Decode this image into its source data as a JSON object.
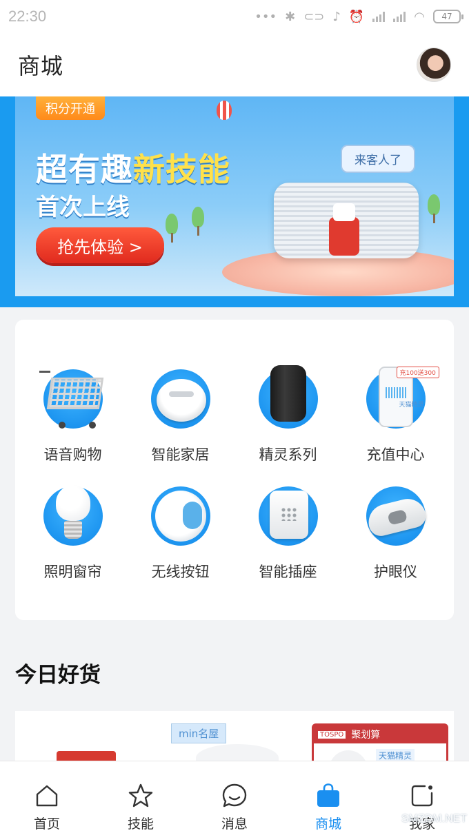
{
  "status_bar": {
    "time": "22:30",
    "battery": "47"
  },
  "header": {
    "title": "商城"
  },
  "banner": {
    "badge": "积分开通",
    "headline_a": "超有趣",
    "headline_b": "新技能",
    "subline": "首次上线",
    "cta": "抢先体验 >",
    "bubble": "来客人了"
  },
  "categories": [
    {
      "label": "语音购物",
      "icon": "shopping-cart-icon"
    },
    {
      "label": "智能家居",
      "icon": "robot-vacuum-icon"
    },
    {
      "label": "精灵系列",
      "icon": "smart-speaker-icon"
    },
    {
      "label": "充值中心",
      "icon": "phone-recharge-icon"
    },
    {
      "label": "照明窗帘",
      "icon": "light-bulb-icon"
    },
    {
      "label": "无线按钮",
      "icon": "wireless-button-icon"
    },
    {
      "label": "智能插座",
      "icon": "smart-plug-icon"
    },
    {
      "label": "护眼仪",
      "icon": "eye-massager-icon"
    }
  ],
  "recharge_tag": "充100送300",
  "recharge_brand": "天猫精灵",
  "deals": {
    "title": "今日好货",
    "tag": "min名屋",
    "promo_title": "聚划算",
    "promo_logo": "TOSPO",
    "promo_brand": "天猫精灵"
  },
  "tab_bar": {
    "tabs": [
      {
        "label": "首页",
        "icon": "home-icon",
        "active": false
      },
      {
        "label": "技能",
        "icon": "star-icon",
        "active": false
      },
      {
        "label": "消息",
        "icon": "message-icon",
        "active": false
      },
      {
        "label": "商城",
        "icon": "shopping-bag-icon",
        "active": true
      },
      {
        "label": "我家",
        "icon": "my-home-icon",
        "active": false
      }
    ],
    "active_color": "#1a8ff0"
  },
  "watermark": "SMZDM.NET"
}
